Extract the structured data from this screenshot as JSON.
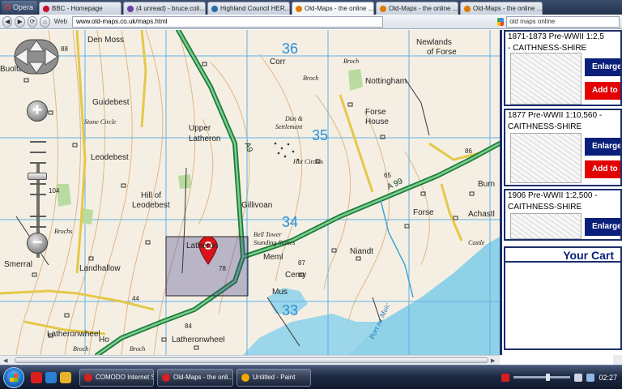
{
  "browser": {
    "menu_label": "Opera",
    "tabs": [
      {
        "label": "BBC - Homepage",
        "color": "#c8102e"
      },
      {
        "label": "(4 unread) - bruce.coli...",
        "color": "#6a3fa0"
      },
      {
        "label": "Highland Council HER...",
        "color": "#2b6cb0"
      },
      {
        "label": "Old-Maps - the online ...",
        "color": "#e07b00",
        "active": true
      },
      {
        "label": "Old-Maps - the online ...",
        "color": "#e07b00"
      },
      {
        "label": "Old-Maps - the online ...",
        "color": "#e07b00"
      }
    ],
    "web_label": "Web",
    "url": "www.old-maps.co.uk/maps.html",
    "search_value": "old maps online"
  },
  "map": {
    "grid_numbers": [
      "36",
      "35",
      "34",
      "33"
    ],
    "places": {
      "den_moss": "Den Moss",
      "buoltach": "Buoltach",
      "guidebest": "Guidebest",
      "stone_circle": "Stone Circle",
      "leodebest": "Leodebest",
      "hill_of": "Hill of",
      "leodebest2": "Leodebest",
      "upper": "Upper",
      "latheron_upper": "Latheron",
      "gillivoan": "Gillivoan",
      "corr": "Corr",
      "broch1": "Broch",
      "broch2": "Broch",
      "dun": "Dùn &",
      "settlement": "Settlement",
      "hut_circles": "Hut Circles",
      "newlands": "Newlands",
      "of_forse": "of Forse",
      "broch3": "Broch",
      "nottingham": "Nottingham",
      "forse": "Forse",
      "house": "House",
      "forse2": "Forse",
      "burn": "Burn",
      "achastl": "Achastl",
      "castle": "Castle",
      "bell_tower": "Bell Tower",
      "standing_stones": "Standing Stones",
      "niandt": "Niandt",
      "meml": "Meml",
      "cemy": "Cemy",
      "mus": "Mus",
      "landhallow": "Landhallow",
      "smerral": "Smerral",
      "brochs": "Brochs",
      "latheronwheel": "Latheronwheel",
      "latheronwheel2": "Latheronwheel",
      "broch4": "Broch",
      "broch5": "Broch",
      "port_na_muic": "Port na Muic",
      "latheron_pin": "Latheron",
      "latheronwheel_ho": "Ho"
    },
    "roads": {
      "a9": "A9",
      "a99": "A 99"
    },
    "heights": {
      "h88": "88",
      "h104": "104",
      "h78": "78",
      "h87": "87",
      "h65": "65",
      "h86": "86",
      "h44": "44",
      "h84": "84",
      "h63": "63"
    },
    "pushpin_color": "#d7141a",
    "selection_color": "#3c3a8c"
  },
  "panel": {
    "cards": [
      {
        "title": "1871-1873 Pre-WWII 1:2,5",
        "subtitle": "- CAITHNESS-SHIRE",
        "enlarge": "Enlarge",
        "add": "Add to"
      },
      {
        "title": "1877 Pre-WWII 1:10,560 -",
        "subtitle": "CAITHNESS-SHIRE",
        "enlarge": "Enlarge",
        "add": "Add to"
      },
      {
        "title": "1906 Pre-WWII 1:2,500 -",
        "subtitle": "CAITHNESS-SHIRE",
        "enlarge": "Enlarge"
      }
    ],
    "cart_title": "Your Cart"
  },
  "taskbar": {
    "tasks": [
      {
        "label": "COMODO Internet S...",
        "color": "#d81e1e"
      },
      {
        "label": "Old-Maps - the onli...",
        "color": "#d81e1e"
      },
      {
        "label": "Untitled - Paint",
        "color": "#f2a900"
      }
    ],
    "clock": "02:27"
  }
}
